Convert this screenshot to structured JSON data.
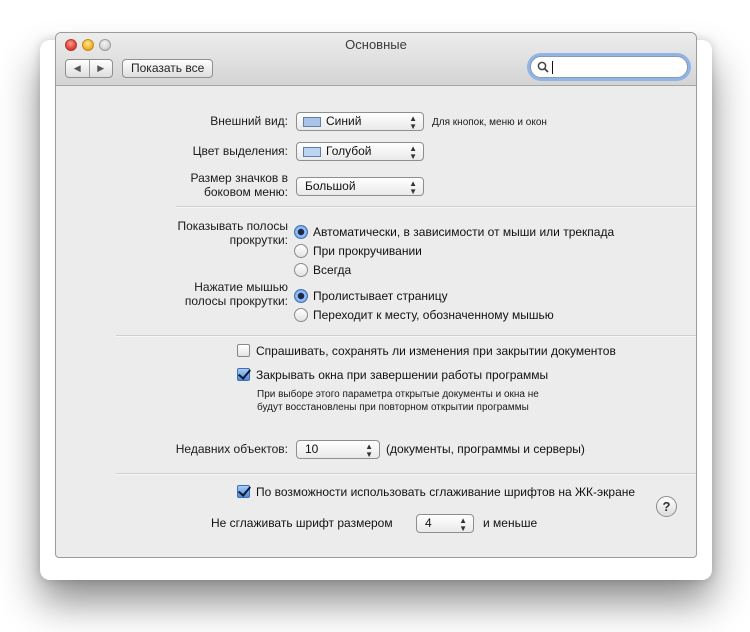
{
  "window": {
    "title": "Основные"
  },
  "toolbar": {
    "back": "◀",
    "forward": "▶",
    "show_all": "Показать все",
    "search_value": ""
  },
  "appearance": {
    "label": "Внешний вид:",
    "value": "Синий",
    "hint": "Для кнопок, меню и окон",
    "swatch_color": "#a9c4e8"
  },
  "highlight": {
    "label": "Цвет выделения:",
    "value": "Голубой",
    "swatch_color": "#bcd4f4"
  },
  "sidebar_icon_size": {
    "label_line1": "Размер значков в",
    "label_line2": "боковом меню:",
    "value": "Большой"
  },
  "scrollbars": {
    "label_line1": "Показывать полосы",
    "label_line2": "прокрутки:",
    "options": [
      {
        "label": "Автоматически, в зависимости от мыши или трекпада",
        "selected": true
      },
      {
        "label": "При прокручивании",
        "selected": false
      },
      {
        "label": "Всегда",
        "selected": false
      }
    ]
  },
  "click_scrollbar": {
    "label_line1": "Нажатие мышью",
    "label_line2": "полосы прокрутки:",
    "options": [
      {
        "label": "Пролистывает страницу",
        "selected": true
      },
      {
        "label": "Переходит к месту, обозначенному мышью",
        "selected": false
      }
    ]
  },
  "documents": {
    "ask_save": {
      "label": "Спрашивать, сохранять ли изменения при закрытии документов",
      "checked": false
    },
    "close_windows": {
      "label": "Закрывать окна при завершении работы программы",
      "checked": true
    },
    "note_line1": "При выборе этого параметра открытые документы и окна не",
    "note_line2": "будут восстановлены при повторном открытии программы"
  },
  "recent": {
    "label": "Недавних объектов:",
    "value": "10",
    "suffix": "(документы, программы и серверы)"
  },
  "font_smoothing": {
    "label": "По возможности использовать сглаживание шрифтов на ЖК-экране",
    "checked": true,
    "min_size_label": "Не сглаживать шрифт размером",
    "min_size_value": "4",
    "min_size_suffix": "и меньше"
  },
  "help": {
    "label": "?"
  },
  "colors": {
    "accent": "#4f8ad8",
    "focus_ring": "#8fb4ea"
  }
}
